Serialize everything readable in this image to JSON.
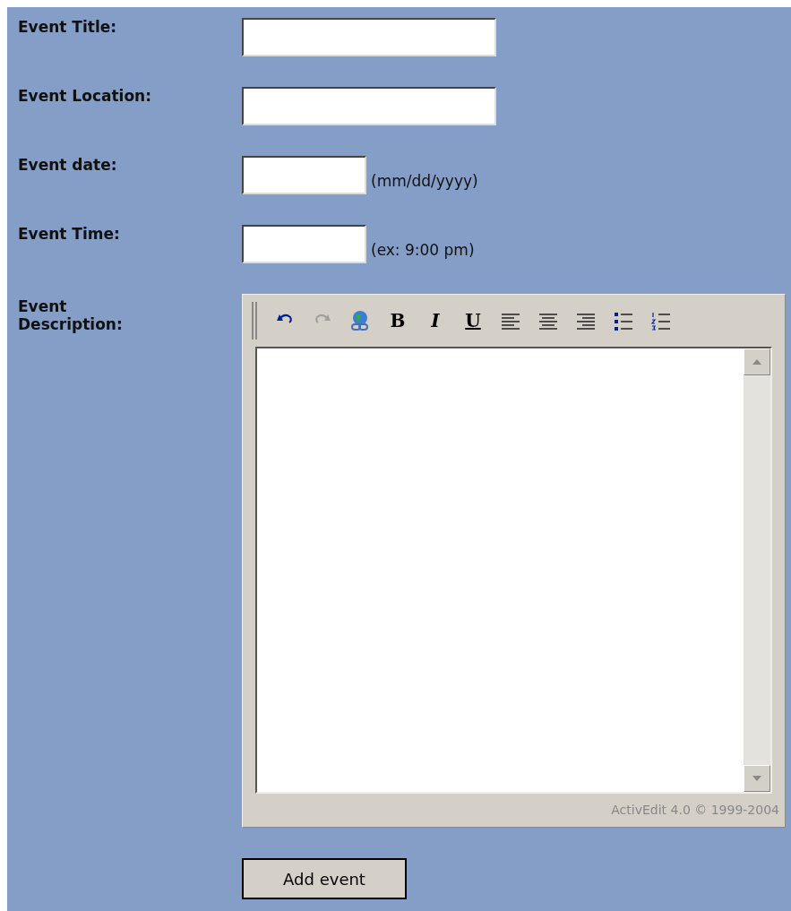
{
  "fields": [
    {
      "label": "Event Title:",
      "kind": "long"
    },
    {
      "label": "Event Location:",
      "kind": "long"
    },
    {
      "label": "Event date:",
      "kind": "short",
      "hint": "(mm/dd/yyyy)"
    },
    {
      "label": "Event Time:",
      "kind": "short",
      "hint": "(ex: 9:00 pm)"
    }
  ],
  "description": {
    "label": "Event Description:",
    "toolbar": [
      {
        "kind": "undo",
        "disabled": false
      },
      {
        "kind": "redo",
        "disabled": true
      },
      {
        "kind": "link",
        "disabled": false
      },
      {
        "kind": "bold",
        "label": "B",
        "disabled": false
      },
      {
        "kind": "italic",
        "label": "I",
        "disabled": false
      },
      {
        "kind": "underline",
        "label": "U",
        "disabled": false
      },
      {
        "kind": "align-left",
        "disabled": false
      },
      {
        "kind": "align-center",
        "disabled": false
      },
      {
        "kind": "align-right",
        "disabled": false
      },
      {
        "kind": "bullets",
        "disabled": false
      },
      {
        "kind": "numbers",
        "disabled": false
      }
    ],
    "footer": "ActivEdit 4.0 © 1999-2004"
  },
  "submit": "Add event"
}
